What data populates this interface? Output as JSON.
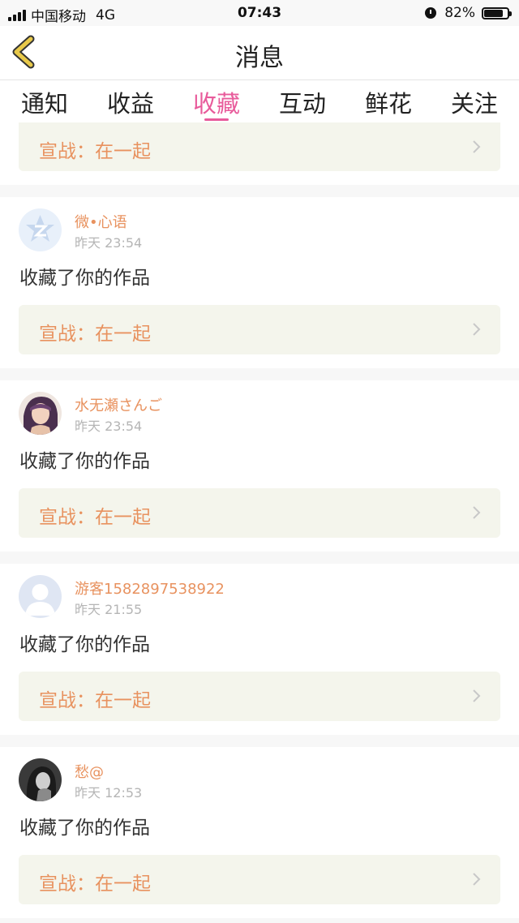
{
  "status_bar": {
    "carrier": "中国移动",
    "network": "4G",
    "time": "07:43",
    "battery": "82%",
    "battery_level": 0.82
  },
  "nav": {
    "title": "消息",
    "back_icon": "chevron-left-icon"
  },
  "tabs": [
    {
      "label": "通知",
      "active": false
    },
    {
      "label": "收益",
      "active": false
    },
    {
      "label": "收藏",
      "active": true
    },
    {
      "label": "互动",
      "active": false
    },
    {
      "label": "鲜花",
      "active": false
    },
    {
      "label": "关注",
      "active": false
    }
  ],
  "partial_item": {
    "link": "宣战：在一起"
  },
  "items": [
    {
      "user": "微•心语",
      "time": "昨天 23:54",
      "message": "收藏了你的作品",
      "link": "宣战：在一起"
    },
    {
      "user": "水无瀬さんご",
      "time": "昨天 23:54",
      "message": "收藏了你的作品",
      "link": "宣战：在一起"
    },
    {
      "user": "游客1582897538922",
      "time": "昨天 21:55",
      "message": "收藏了你的作品",
      "link": "宣战：在一起"
    },
    {
      "user": "愁@",
      "time": "昨天 12:53",
      "message": "收藏了你的作品",
      "link": "宣战：在一起"
    }
  ],
  "colors": {
    "accent": "#e85b9b",
    "username": "#e8925f",
    "link_bg": "#f4f5ec",
    "back_icon": "#e8c94a"
  }
}
